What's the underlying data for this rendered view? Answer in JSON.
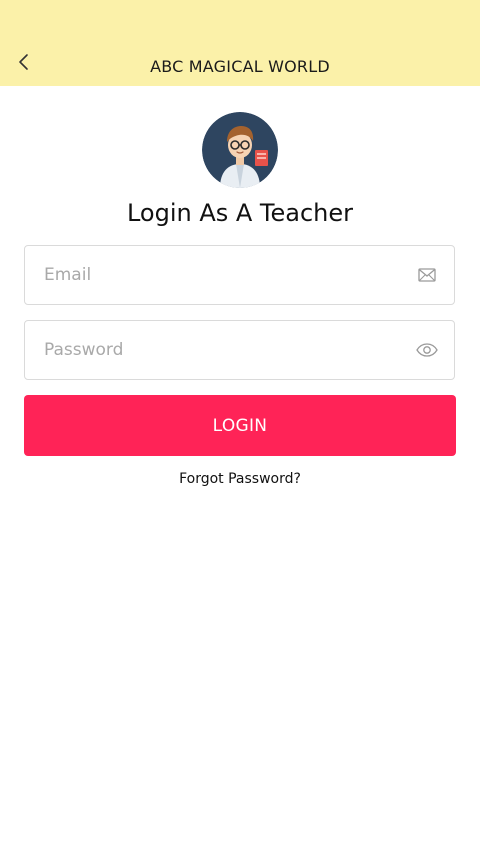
{
  "header": {
    "title": "ABC MAGICAL WORLD",
    "back_icon": "chevron-left-icon",
    "background_color": "#fbf1a9"
  },
  "main": {
    "avatar_icon": "teacher-avatar-icon",
    "heading": "Login As A Teacher",
    "email": {
      "placeholder": "Email",
      "value": "",
      "icon": "envelope-icon"
    },
    "password": {
      "placeholder": "Password",
      "value": "",
      "icon": "eye-icon"
    },
    "login_button": {
      "label": "LOGIN",
      "color": "#ff2357"
    },
    "forgot_password": "Forgot Password?"
  }
}
